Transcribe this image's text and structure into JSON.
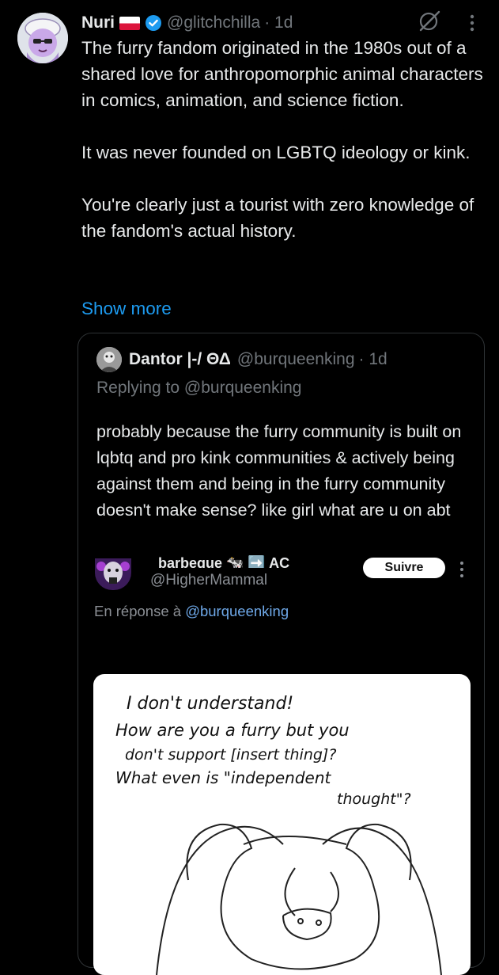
{
  "tweet": {
    "name": "Nuri",
    "handle": "@glitchchilla",
    "time": "· 1d",
    "paragraphs": [
      "The furry fandom originated in the 1980s out of a shared love for anthropomorphic animal characters in comics, animation, and science fiction.",
      "It was never founded on LGBTQ ideology or kink.",
      "You're clearly just a tourist with zero knowledge of the fandom's actual history."
    ],
    "show_more": "Show more",
    "icons": [
      "avatar",
      "poland-flag-icon",
      "verified-badge-icon",
      "grok-icon",
      "more-icon"
    ]
  },
  "quote": {
    "name": "Dantor |-/ ΘΔ",
    "handle": "@burqueenking",
    "time": "· 1d",
    "replying_to": "Replying to @burqueenking",
    "text": "probably because the furry community is built on lqbtq and pro kink communities & actively being against them and being in the furry community doesn't make sense? like girl what are u on abt",
    "embedded": {
      "name": "barbeque 🐄 ➡️ AC",
      "handle": "@HigherMammal",
      "follow_label": "Suivre",
      "reply_prefix": "En réponse à ",
      "reply_link": "@burqueenking",
      "drawing_text": [
        "I don't understand!",
        "How are you a furry but you",
        "don't support [insert thing]?",
        "What even is \"independent",
        "thought\"?"
      ]
    }
  }
}
